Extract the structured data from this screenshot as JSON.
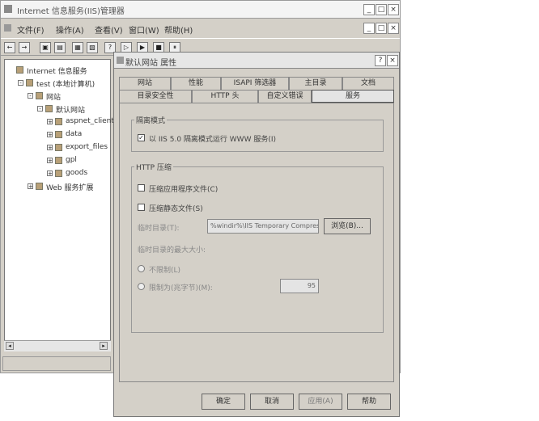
{
  "main_window": {
    "title": "Internet 信息服务(IIS)管理器",
    "controls": [
      "_",
      "□",
      "×"
    ],
    "menu": [
      "文件(F)",
      "操作(A)",
      "查看(V)",
      "窗口(W)",
      "帮助(H)"
    ],
    "menu_controls": [
      "_",
      "□",
      "×"
    ],
    "toolbar": [
      "←",
      "→",
      "▣",
      "▤",
      "▦",
      "▧",
      "?",
      "▷",
      "▶",
      "■",
      "⏸"
    ]
  },
  "tree": [
    {
      "label": "Internet 信息服务",
      "indent": 0,
      "exp": ""
    },
    {
      "label": "test (本地计算机)",
      "indent": 1,
      "exp": "-"
    },
    {
      "label": "网站",
      "indent": 2,
      "exp": "-"
    },
    {
      "label": "默认网站",
      "indent": 3,
      "exp": "-"
    },
    {
      "label": "aspnet_client",
      "indent": 4,
      "exp": "+"
    },
    {
      "label": "data",
      "indent": 4,
      "exp": "+"
    },
    {
      "label": "export_files",
      "indent": 4,
      "exp": "+"
    },
    {
      "label": "gpl",
      "indent": 4,
      "exp": "+"
    },
    {
      "label": "goods",
      "indent": 4,
      "exp": "+"
    },
    {
      "label": "Web 服务扩展",
      "indent": 2,
      "exp": "+"
    }
  ],
  "dialog": {
    "title": "默认网站 属性",
    "controls": [
      "?",
      "×"
    ],
    "tabs_row1": [
      "网站",
      "性能",
      "ISAPI 筛选器",
      "主目录",
      "文档"
    ],
    "tabs_row2": [
      "目录安全性",
      "HTTP 头",
      "自定义错误",
      "服务"
    ],
    "group1": {
      "title": "隔离模式",
      "checkbox": "以 IIS 5.0 隔离模式运行 WWW 服务(I)"
    },
    "group2": {
      "title": "HTTP 压缩",
      "check1": "压缩应用程序文件(C)",
      "check2": "压缩静态文件(S)",
      "temp_dir_label": "临时目录(T):",
      "temp_dir_value": "%windir%\\IIS Temporary Compres",
      "browse_button": "浏览(B)...",
      "max_size_label": "临时目录的最大大小:",
      "radio1": "不限制(L)",
      "radio2": "限制为(兆字节)(M):",
      "limit_value": "95"
    },
    "buttons": [
      "确定",
      "取消",
      "应用(A)",
      "帮助"
    ]
  }
}
